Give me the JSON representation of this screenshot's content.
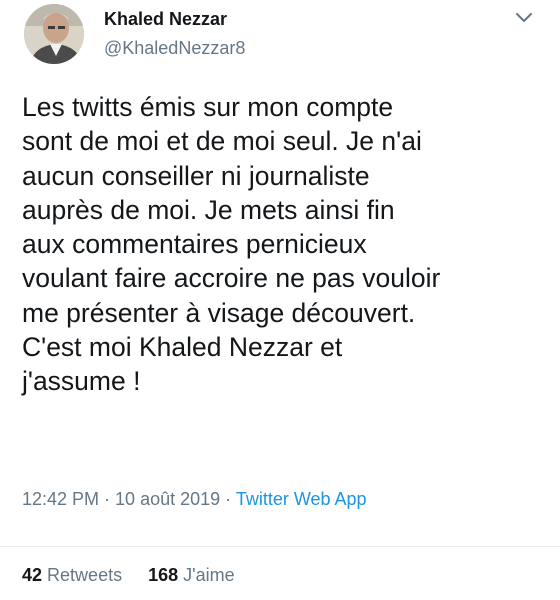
{
  "author": {
    "display_name": "Khaled Nezzar",
    "handle": "@KhaledNezzar8"
  },
  "tweet": {
    "text": "Les twitts émis sur mon compte\nsont de moi et de moi seul. Je n'ai\naucun conseiller ni journaliste\nauprès de moi. Je mets ainsi fin\naux commentaires pernicieux\nvoulant faire accroire ne pas vouloir\nme présenter à visage découvert.\nC'est moi  Khaled Nezzar et\nj'assume !"
  },
  "meta": {
    "time": "12:42 PM",
    "separator": " · ",
    "date": "10 août 2019",
    "separator2": " · ",
    "source": "Twitter Web App"
  },
  "stats": {
    "retweets_count": "42",
    "retweets_label": "Retweets",
    "likes_count": "168",
    "likes_label": "J'aime"
  },
  "icons": {
    "menu": "chevron-down-icon"
  },
  "colors": {
    "text": "#14171a",
    "secondary": "#657786",
    "link": "#1b95e0",
    "divider": "#e6ecf0"
  }
}
